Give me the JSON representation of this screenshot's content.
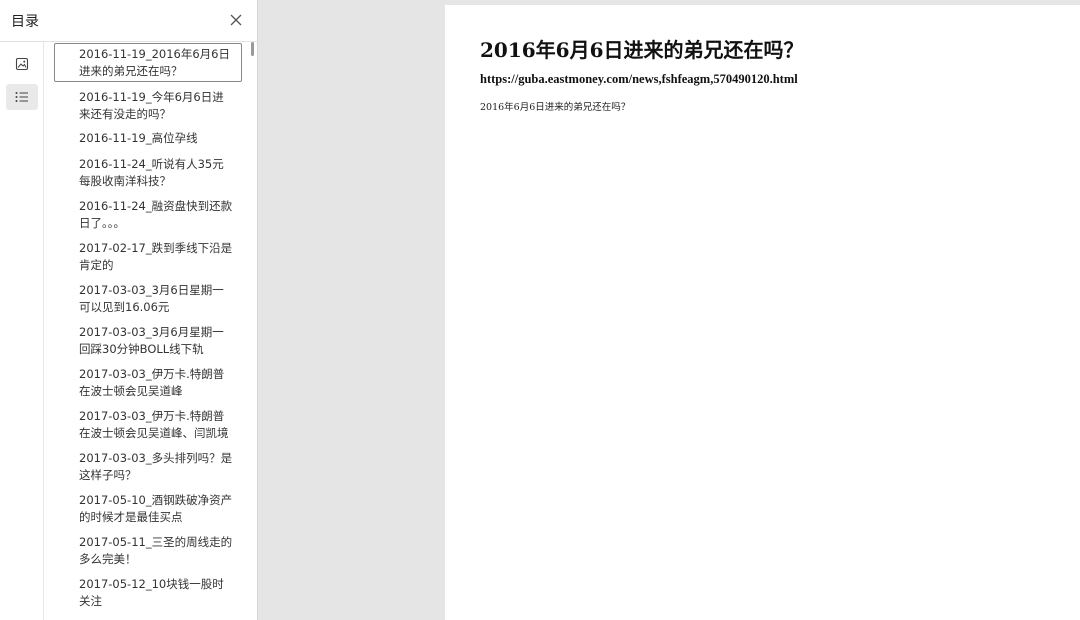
{
  "sidebar": {
    "title": "目录",
    "close_icon": "close-icon",
    "rail": [
      {
        "icon": "image-thumbnail-icon"
      },
      {
        "icon": "list-outline-icon",
        "active": true
      }
    ],
    "toc": [
      {
        "label": "2016-11-19_2016年6月6日进来的弟兄还在吗？",
        "selected": true
      },
      {
        "label": "2016-11-19_今年6月6日进来还有没走的吗？"
      },
      {
        "label": "2016-11-19_高位孕线"
      },
      {
        "label": "2016-11-24_听说有人35元每股收南洋科技？"
      },
      {
        "label": "2016-11-24_融资盘快到还款日了。。。"
      },
      {
        "label": "2017-02-17_跌到季线下沿是肯定的"
      },
      {
        "label": "2017-03-03_3月6日星期一可以见到16.06元"
      },
      {
        "label": "2017-03-03_3月6月星期一回踩30分钟BOLL线下轨"
      },
      {
        "label": "2017-03-03_伊万卡.特朗普在波士顿会见吴道峰"
      },
      {
        "label": "2017-03-03_伊万卡.特朗普在波士顿会见吴道峰、闫凯境"
      },
      {
        "label": "2017-03-03_多头排列吗？是这样子吗？"
      },
      {
        "label": "2017-05-10_酒钢跌破净资产的时候才是最佳买点"
      },
      {
        "label": "2017-05-11_三圣的周线走的多么完美！"
      },
      {
        "label": "2017-05-12_10块钱一股时关注"
      }
    ]
  },
  "document": {
    "title": "2016年6月6日进来的弟兄还在吗？",
    "url": "https://guba.eastmoney.com/news,fshfeagm,570490120.html",
    "body": "2016年6月6日进来的弟兄还在吗？"
  }
}
